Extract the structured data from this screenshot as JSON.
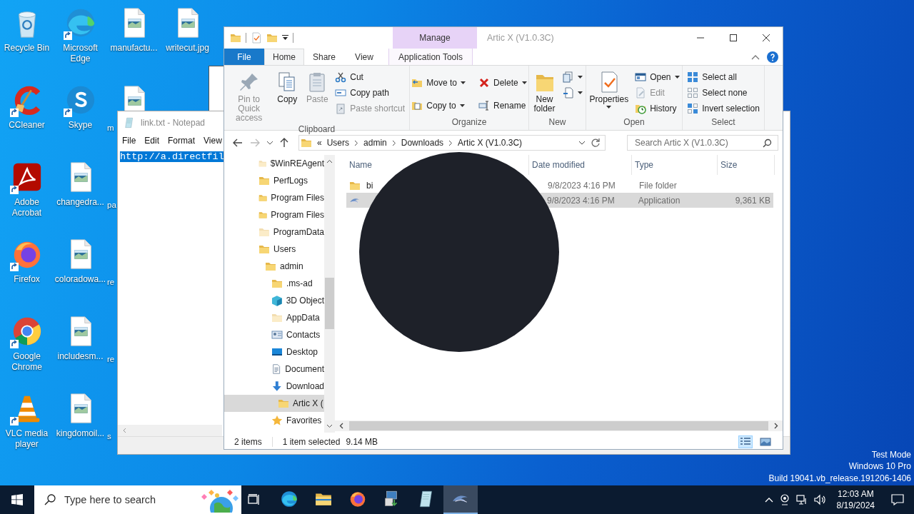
{
  "desktop": {
    "icons": [
      {
        "label": "Recycle Bin",
        "shortcut": false
      },
      {
        "label": "CCleaner",
        "shortcut": true
      },
      {
        "label": "Adobe Acrobat",
        "shortcut": true
      },
      {
        "label": "Firefox",
        "shortcut": true
      },
      {
        "label": "Google Chrome",
        "shortcut": true
      },
      {
        "label": "VLC media player",
        "shortcut": true
      },
      {
        "label": "Microsoft Edge",
        "shortcut": true
      },
      {
        "label": "Skype",
        "shortcut": true
      },
      {
        "label": "changedra...",
        "shortcut": false
      },
      {
        "label": "coloradowa...",
        "shortcut": false
      },
      {
        "label": "includesm...",
        "shortcut": false
      },
      {
        "label": "kingdomoil...",
        "shortcut": false
      },
      {
        "label": "manufactu...",
        "shortcut": false
      },
      {
        "label": "m",
        "shortcut": false
      },
      {
        "label": "pa"
      },
      {
        "label": "re"
      },
      {
        "label": "re"
      },
      {
        "label": "s"
      },
      {
        "label": "writecut.jpg",
        "shortcut": false
      }
    ]
  },
  "notepad": {
    "title": "link.txt - Notepad",
    "menu": [
      "File",
      "Edit",
      "Format",
      "View"
    ],
    "text": "http://a.directfil",
    "text_selected": true
  },
  "explorer": {
    "title": "Artic X (V1.0.3C)",
    "context_tab": "Manage",
    "tabs": [
      {
        "label": "File",
        "kind": "file",
        "selected": false
      },
      {
        "label": "Home",
        "kind": "tab",
        "selected": true
      },
      {
        "label": "Share",
        "kind": "tab",
        "selected": false
      },
      {
        "label": "View",
        "kind": "tab",
        "selected": false
      },
      {
        "label": "Application Tools",
        "kind": "context",
        "selected": false
      }
    ],
    "ribbon": [
      {
        "label": "Clipboard",
        "columns": [
          {
            "kind": "large",
            "items": [
              {
                "label": "Pin to Quick access",
                "disabled": true,
                "dropdown": false
              }
            ]
          },
          {
            "kind": "large",
            "items": [
              {
                "label": "Copy",
                "disabled": false,
                "dropdown": false
              }
            ]
          },
          {
            "kind": "large",
            "items": [
              {
                "label": "Paste",
                "disabled": true,
                "dropdown": false
              }
            ]
          },
          {
            "kind": "small",
            "items": [
              {
                "label": "Cut",
                "disabled": false,
                "dropdown": false
              },
              {
                "label": "Copy path",
                "disabled": false,
                "dropdown": false
              },
              {
                "label": "Paste shortcut",
                "disabled": true,
                "dropdown": false
              }
            ]
          }
        ]
      },
      {
        "label": "Organize",
        "columns": [
          {
            "kind": "small",
            "items": [
              {
                "label": "Move to",
                "disabled": false,
                "dropdown": true
              },
              {
                "label": "Copy to",
                "disabled": false,
                "dropdown": true
              }
            ]
          },
          {
            "kind": "small",
            "items": [
              {
                "label": "Delete",
                "disabled": false,
                "dropdown": true
              },
              {
                "label": "Rename",
                "disabled": false,
                "dropdown": false
              }
            ]
          }
        ]
      },
      {
        "label": "New",
        "columns": [
          {
            "kind": "large",
            "items": [
              {
                "label": "New folder",
                "disabled": false,
                "dropdown": false
              }
            ]
          },
          {
            "kind": "small",
            "items": [
              {
                "dropdown": true
              },
              {
                "dropdown": true
              }
            ]
          }
        ]
      },
      {
        "label": "Open",
        "columns": [
          {
            "kind": "large",
            "items": [
              {
                "label": "Properties",
                "disabled": false,
                "dropdown": true
              }
            ]
          },
          {
            "kind": "small",
            "items": [
              {
                "label": "Open",
                "disabled": false,
                "dropdown": true
              },
              {
                "label": "Edit",
                "disabled": true,
                "dropdown": false
              },
              {
                "label": "History",
                "disabled": false,
                "dropdown": false
              }
            ]
          }
        ]
      },
      {
        "label": "Select",
        "columns": [
          {
            "kind": "small",
            "items": [
              {
                "label": "Select all",
                "disabled": false,
                "dropdown": false
              },
              {
                "label": "Select none",
                "disabled": false,
                "dropdown": false
              },
              {
                "label": "Invert selection",
                "disabled": false,
                "dropdown": false
              }
            ]
          }
        ]
      }
    ],
    "address": {
      "prefix": "«",
      "segments": [
        "Users",
        "admin",
        "Downloads",
        "Artic X (V1.0.3C)"
      ]
    },
    "search": {
      "placeholder": "Search Artic X (V1.0.3C)"
    },
    "nav": [
      {
        "label": "$WinREAgent",
        "kind": "hidden-folder",
        "selected": false
      },
      {
        "label": "PerfLogs",
        "kind": "folder",
        "selected": false
      },
      {
        "label": "Program Files",
        "kind": "folder",
        "selected": false
      },
      {
        "label": "Program Files",
        "kind": "folder",
        "selected": false
      },
      {
        "label": "ProgramData",
        "kind": "hidden-folder",
        "selected": false
      },
      {
        "label": "Users",
        "kind": "folder",
        "selected": false,
        "children": [
          {
            "label": "admin",
            "kind": "folder",
            "selected": false,
            "children": [
              {
                "label": ".ms-ad",
                "kind": "folder",
                "selected": false
              },
              {
                "label": "3D Object",
                "kind": "objects",
                "selected": false
              },
              {
                "label": "AppData",
                "kind": "hidden-folder",
                "selected": false
              },
              {
                "label": "Contacts",
                "kind": "contacts",
                "selected": false
              },
              {
                "label": "Desktop",
                "kind": "desktop",
                "selected": false
              },
              {
                "label": "Document",
                "kind": "documents",
                "selected": false
              },
              {
                "label": "Download",
                "kind": "downloads",
                "selected": false,
                "children": [
                  {
                    "label": "Artic X (",
                    "kind": "folder",
                    "selected": true
                  }
                ]
              },
              {
                "label": "Favorites",
                "kind": "favorites",
                "selected": false
              }
            ]
          }
        ]
      }
    ],
    "columns": [
      "Name",
      "Date modified",
      "Type",
      "Size"
    ],
    "rows": [
      {
        "kind": "folder",
        "name": "bi",
        "date": "9/8/2023 4:16 PM",
        "type": "File folder",
        "selected": false
      },
      {
        "kind": "app",
        "date": "9/8/2023 4:16 PM",
        "type": "Application",
        "size": "9,361 KB",
        "selected": true
      }
    ],
    "status": {
      "count": "2 items",
      "selection": "1 item selected",
      "size": "9.14 MB"
    },
    "views": [
      {
        "kind": "details",
        "selected": true
      },
      {
        "kind": "large-icons",
        "selected": false
      }
    ]
  },
  "taskbar": {
    "search_placeholder": "Type here to search",
    "apps": [
      {
        "active": false
      },
      {
        "active": false
      },
      {
        "active": false
      },
      {
        "active": false
      },
      {
        "active": false
      },
      {
        "active": true
      }
    ],
    "time": "12:03 AM",
    "date": "8/19/2024"
  },
  "system_notice": [
    "Test Mode",
    "Windows 10 Pro",
    "Build 19041.vb_release.191206-1406"
  ]
}
